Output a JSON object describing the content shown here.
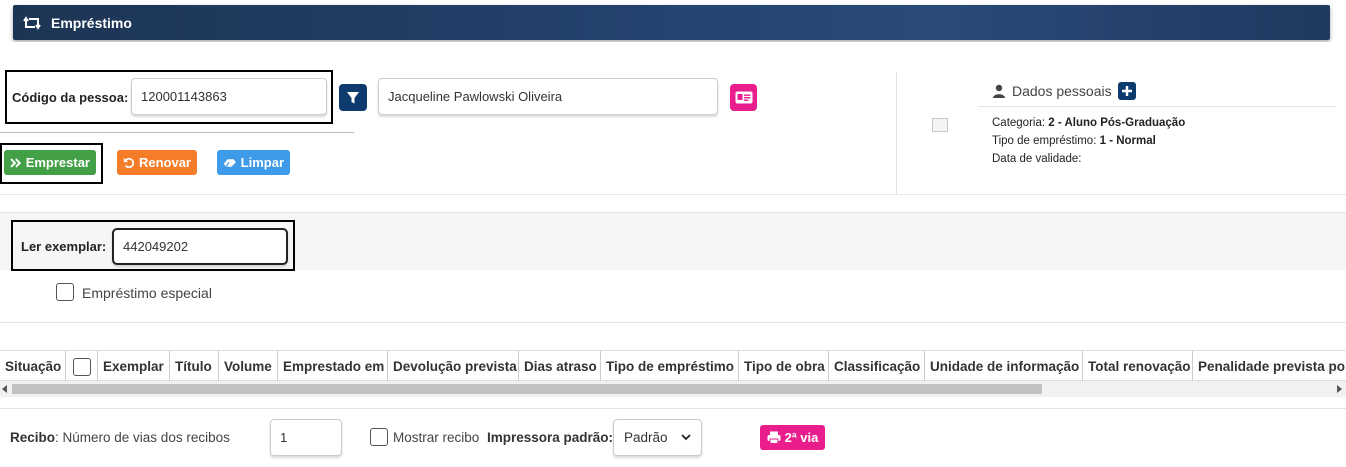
{
  "header": {
    "title": "Empréstimo",
    "icon": "retweet-icon"
  },
  "person": {
    "code_label": "Código da pessoa:",
    "code_value": "120001143863",
    "name_value": "Jacqueline Pawlowski Oliveira"
  },
  "actions": {
    "lend": "Emprestar",
    "renew": "Renovar",
    "clear": "Limpar"
  },
  "personal_data": {
    "title": "Dados pessoais",
    "category_label": "Categoria:",
    "category_value": "2 - Aluno Pós-Graduação",
    "loan_type_label": "Tipo de empréstimo:",
    "loan_type_value": "1 - Normal",
    "validity_label": "Data de validade:"
  },
  "exemplar": {
    "label": "Ler exemplar:",
    "value": "442049202"
  },
  "special_loan": {
    "label": "Empréstimo especial"
  },
  "table": {
    "columns": [
      "Situação",
      "",
      "Exemplar",
      "Título",
      "Volume",
      "Emprestado em",
      "Devolução prevista",
      "Dias atraso",
      "Tipo de empréstimo",
      "Tipo de obra",
      "Classificação",
      "Unidade de informação",
      "Total renovação",
      "Penalidade prevista po"
    ]
  },
  "footer": {
    "receipt_label": "Recibo",
    "copies_label": ": Número de vias dos recibos",
    "copies_value": "1",
    "show_receipt_label": "Mostrar recibo",
    "default_printer_label": "Impressora padrão:",
    "printer_value": "Padrão",
    "second_copy": "2ª via"
  },
  "colors": {
    "header_bg": "#1f3a60",
    "lend_btn": "#43a047",
    "renew_btn": "#f57c28",
    "clear_btn": "#3d9be9",
    "filter_btn": "#0d3b6e",
    "pink_btn": "#e91e8c"
  }
}
